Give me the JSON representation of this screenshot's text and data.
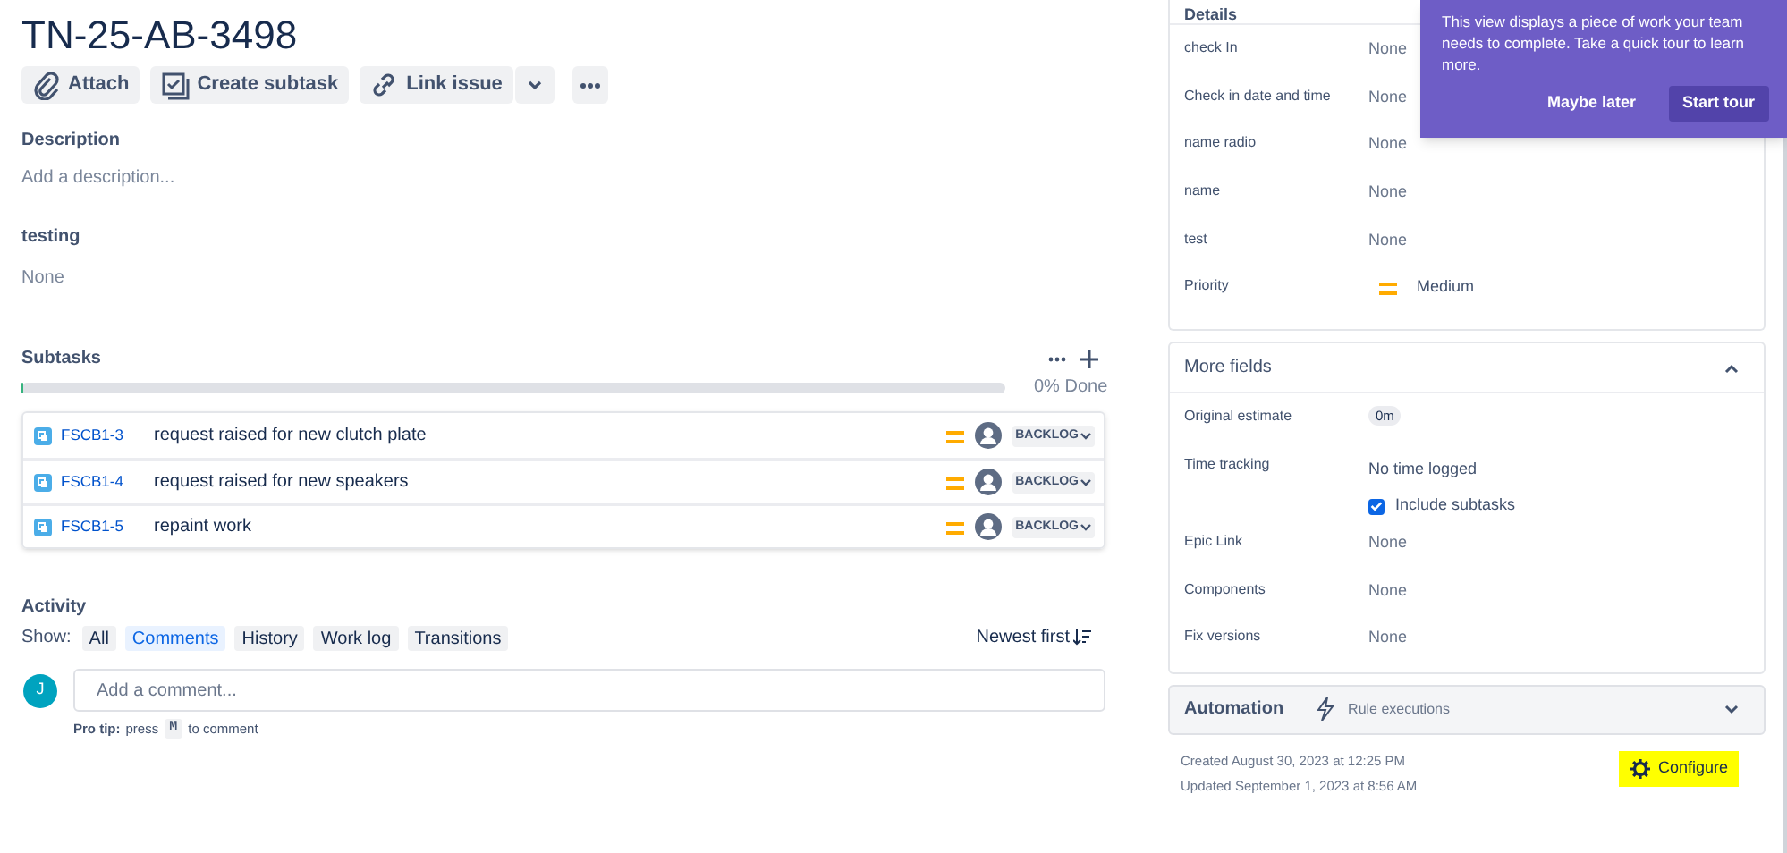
{
  "issue": {
    "key": "TN-25-AB-3498"
  },
  "toolbar": [
    {
      "label": "Attach",
      "kind": "attach"
    },
    {
      "label": "Create subtask",
      "kind": "subtask"
    },
    {
      "label": "Link issue",
      "kind": "link"
    }
  ],
  "description": {
    "heading": "Description",
    "placeholder": "Add a description..."
  },
  "testing": {
    "heading": "testing",
    "value": "None"
  },
  "subtasks": {
    "heading": "Subtasks",
    "level": 0,
    "progress_label": "0% Done",
    "rows": [
      {
        "key": "FSCB1-3",
        "summary": "request raised for new clutch plate",
        "status": "BACKLOG"
      },
      {
        "key": "FSCB1-4",
        "summary": "request raised for new speakers",
        "status": "BACKLOG"
      },
      {
        "key": "FSCB1-5",
        "summary": "repaint work",
        "status": "BACKLOG"
      }
    ]
  },
  "activity": {
    "heading": "Activity",
    "show_label": "Show:",
    "filters": [
      {
        "label": "All",
        "selected": false
      },
      {
        "label": "Comments",
        "selected": true
      },
      {
        "label": "History",
        "selected": false
      },
      {
        "label": "Work log",
        "selected": false
      },
      {
        "label": "Transitions",
        "selected": false
      }
    ],
    "sort": "Newest first",
    "avatar": "J",
    "comment_placeholder": "Add a comment...",
    "tip_bold": "Pro tip:",
    "tip_press": "press",
    "tip_key": "M",
    "tip_rest": "to comment"
  },
  "details": {
    "heading": "Details",
    "fields": [
      {
        "label": "check In",
        "value": "None"
      },
      {
        "label": "Check in date and time",
        "value": "None"
      },
      {
        "label": "name radio",
        "value": "None"
      },
      {
        "label": "name",
        "value": "None"
      },
      {
        "label": "test",
        "value": "None"
      },
      {
        "label": "Priority",
        "value": "Medium",
        "kind": "priority"
      }
    ]
  },
  "more_fields": {
    "heading": "More fields",
    "expanded": true,
    "fields": [
      {
        "label": "Original estimate",
        "value": "0m",
        "kind": "chip"
      },
      {
        "label": "Time tracking",
        "value": "No time logged",
        "kind": "tracking",
        "checkbox_label": "Include subtasks",
        "checked": true
      },
      {
        "label": "Epic Link",
        "value": "None"
      },
      {
        "label": "Components",
        "value": "None"
      },
      {
        "label": "Fix versions",
        "value": "None"
      }
    ]
  },
  "automation": {
    "heading": "Automation",
    "sub": "Rule executions",
    "expanded": false
  },
  "created": "Created August 30, 2023 at 12:25 PM",
  "updated": "Updated September 1, 2023 at 8:56 AM",
  "configure": "Configure",
  "tour": {
    "text": "This view displays a piece of work your team needs to complete. Take a quick tour to learn more.",
    "buttons": [
      "Maybe later",
      "Start tour"
    ]
  }
}
